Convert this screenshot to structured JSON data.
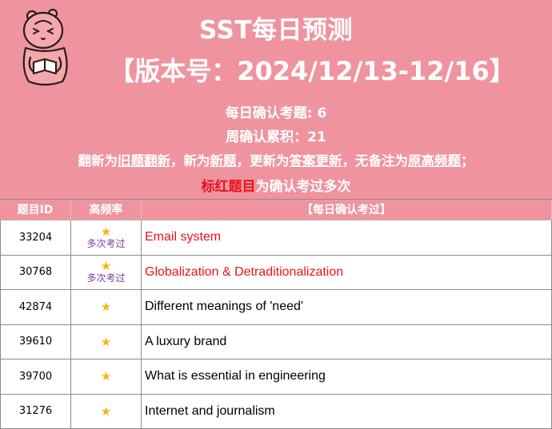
{
  "header": {
    "title": "SST每日预测",
    "version": "【版本号：2024/12/13-12/16】",
    "daily_count_label": "每日确认考题: ",
    "daily_count": "6",
    "weekly_total_label": "周确认累积：",
    "weekly_total": "21",
    "legend": {
      "p1": "翻新为",
      "old_fanxin": "旧题翻新",
      "p2": "，新为",
      "new_q": "新题",
      "p3": "，更新为",
      "ans_upd": "答案更新",
      "p4": "，无备注为",
      "orig_hf": "原高频题",
      "p5": "；"
    },
    "red_note_highlight": "标红题目",
    "red_note_rest": "为确认考过多次"
  },
  "table": {
    "columns": [
      "题目ID",
      "高频率",
      "【每日确认考过】"
    ],
    "rows": [
      {
        "id": "33204",
        "star": "★",
        "note": "多次考过",
        "topic": "Email system",
        "hot": true
      },
      {
        "id": "30768",
        "star": "★",
        "note": "多次考过",
        "topic": "Globalization & Detraditionalization",
        "hot": true
      },
      {
        "id": "42874",
        "star": "★",
        "note": "",
        "topic": "Different meanings of 'need'",
        "hot": false
      },
      {
        "id": "39610",
        "star": "★",
        "note": "",
        "topic": "A luxury brand",
        "hot": false
      },
      {
        "id": "39700",
        "star": "★",
        "note": "",
        "topic": "What is essential in engineering",
        "hot": false
      },
      {
        "id": "31276",
        "star": "★",
        "note": "",
        "topic": "Internet and journalism",
        "hot": false
      }
    ]
  },
  "colors": {
    "header_bg": "#ef949e",
    "hot_text": "#e8121a",
    "star": "#f2b416",
    "note": "#7a3fa0"
  },
  "icons": {
    "mascot": "reading-bear-icon"
  }
}
